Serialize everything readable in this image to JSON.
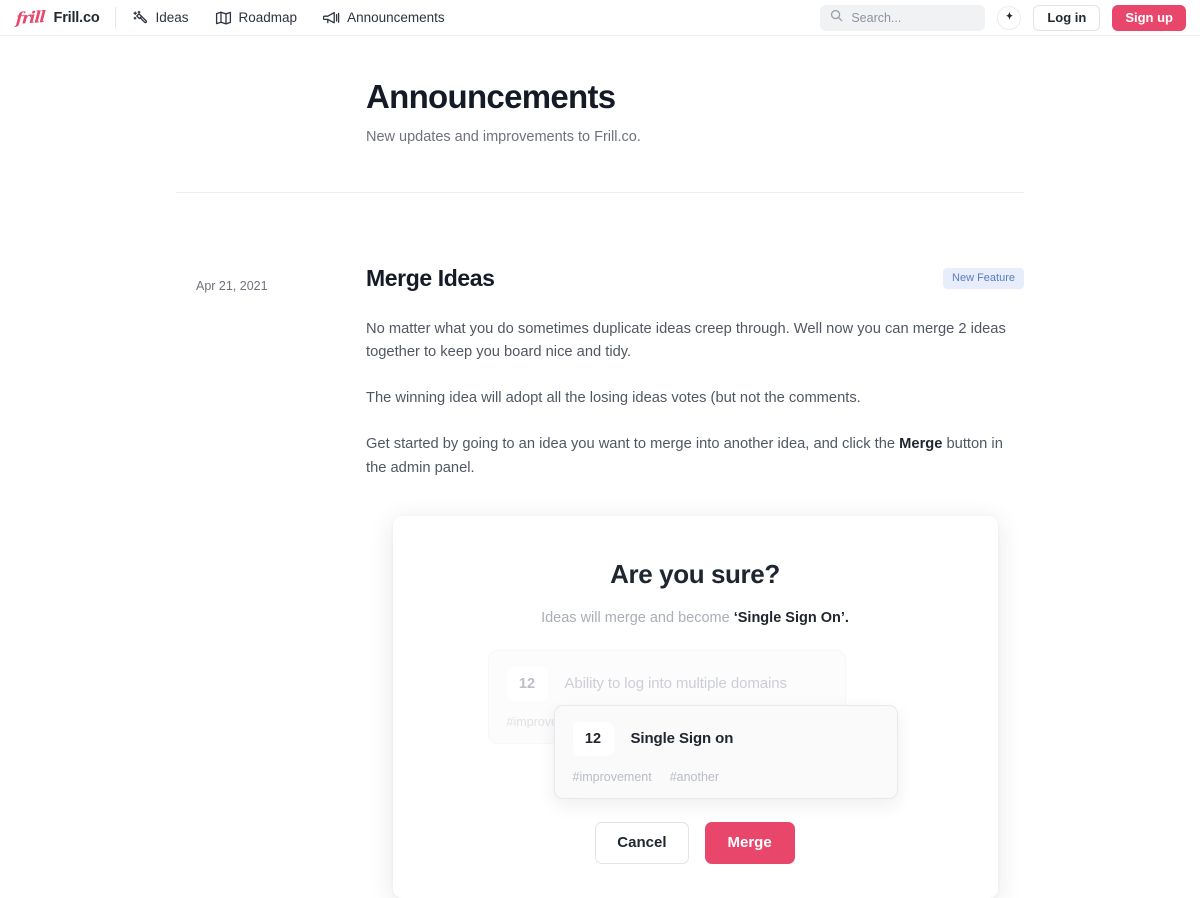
{
  "navbar": {
    "logo_text": "frill",
    "brand": "Frill.co",
    "links": [
      {
        "label": "Ideas",
        "icon": "magic-wand-icon"
      },
      {
        "label": "Roadmap",
        "icon": "map-icon"
      },
      {
        "label": "Announcements",
        "icon": "megaphone-icon"
      }
    ],
    "search": {
      "placeholder": "Search...",
      "value": "",
      "icon": "search-icon"
    },
    "spark_icon": "sparkle-icon",
    "login_label": "Log in",
    "signup_label": "Sign up"
  },
  "header": {
    "title": "Announcements",
    "subtitle": "New updates and improvements to Frill.co."
  },
  "post": {
    "date": "Apr 21, 2021",
    "title": "Merge Ideas",
    "badge": "New Feature",
    "paragraphs": [
      "No matter what you do sometimes duplicate ideas creep through. Well now you can merge 2 ideas together to keep you board nice and tidy.",
      "The winning idea will adopt all the losing ideas votes (but not the comments."
    ],
    "paragraph3": {
      "before": "Get started by going to an idea you want to merge into another idea, and click the ",
      "bold": "Merge",
      "after": " button in the admin panel."
    }
  },
  "screenshot": {
    "title": "Are you sure?",
    "subtitle_before": "Ideas will merge and become ",
    "subtitle_bold": "‘Single Sign On’.",
    "cards": [
      {
        "votes": "12",
        "title": "Ability to log into multiple domains",
        "tags": [
          "#improvement"
        ]
      },
      {
        "votes": "12",
        "title": "Single Sign on",
        "tags": [
          "#improvement",
          "#another"
        ]
      }
    ],
    "cancel_label": "Cancel",
    "merge_label": "Merge"
  },
  "colors": {
    "accent": "#e8466b",
    "badge_bg": "#e7edfa",
    "badge_text": "#5b7cc0",
    "text": "#1f2733",
    "muted": "#6d727c"
  }
}
